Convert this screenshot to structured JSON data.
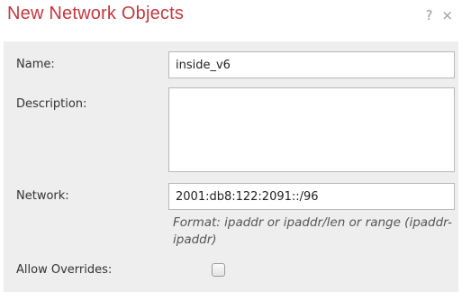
{
  "dialog": {
    "title": "New Network Objects",
    "help_label": "?",
    "close_label": "×"
  },
  "form": {
    "name_label": "Name:",
    "name_value": "inside_v6",
    "description_label": "Description:",
    "description_value": "",
    "network_label": "Network:",
    "network_value": "2001:db8:122:2091::/96",
    "network_hint": "Format: ipaddr or ipaddr/len or range (ipaddr-ipaddr)",
    "allow_overrides_label": "Allow Overrides:",
    "allow_overrides_checked": false
  },
  "colors": {
    "title": "#c4383c",
    "panel_background": "#eeeeee"
  }
}
